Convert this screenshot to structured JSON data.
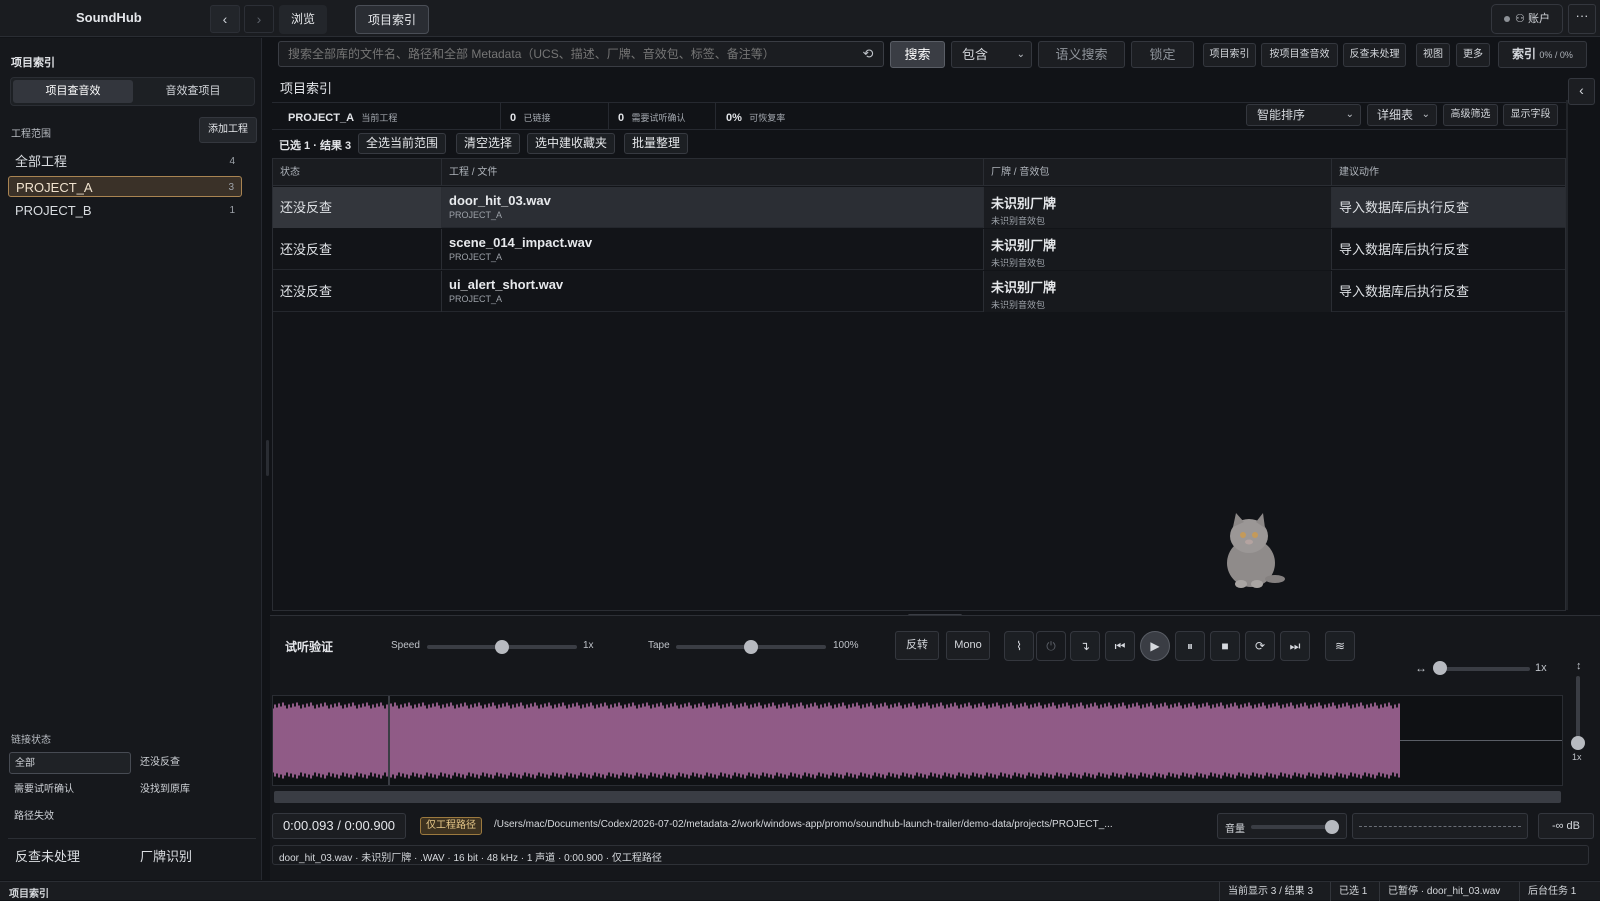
{
  "app": {
    "name": "SoundHub"
  },
  "nav": {
    "back": "‹",
    "forward": "›",
    "tabs": [
      "浏览",
      "项目索引"
    ],
    "account": "账户",
    "more": "···"
  },
  "search": {
    "placeholder": "搜索全部库的文件名、路径和全部 Metadata（UCS、描述、厂牌、音效包、标签、备注等）",
    "button": "搜索",
    "mode": "包含",
    "semantic": "语义搜索",
    "lock": "锁定"
  },
  "toolbar": {
    "items": [
      "项目索引",
      "按项目查音效",
      "反查未处理",
      "视图",
      "更多"
    ],
    "index_label": "索引",
    "index_value": "0% / 0%"
  },
  "sidebar": {
    "title": "项目索引",
    "seg": [
      "项目查音效",
      "音效查项目"
    ],
    "scope_label": "工程范围",
    "add_project": "添加工程",
    "projects": [
      {
        "name": "全部工程",
        "count": "4"
      },
      {
        "name": "PROJECT_A",
        "count": "3"
      },
      {
        "name": "PROJECT_B",
        "count": "1"
      }
    ],
    "link_label": "链接状态",
    "link_filters": [
      "全部",
      "还没反查",
      "需要试听确认",
      "没找到原库",
      "路径失效"
    ],
    "bottom": [
      "反查未处理",
      "厂牌识别"
    ]
  },
  "main": {
    "title": "项目索引",
    "summary": {
      "project": "PROJECT_A",
      "project_label": "当前工程",
      "linked": "0",
      "linked_label": "已链接",
      "confirm": "0",
      "confirm_label": "需要试听确认",
      "recover": "0%",
      "recover_label": "可恢复率"
    },
    "sort": "智能排序",
    "view": "详细表",
    "adv_filter": "高级筛选",
    "fields": "显示字段",
    "selection": "已选 1 · 结果 3",
    "actions": [
      "全选当前范围",
      "清空选择",
      "选中建收藏夹",
      "批量整理"
    ]
  },
  "table": {
    "columns": [
      "状态",
      "工程 / 文件",
      "厂牌 / 音效包",
      "建议动作"
    ],
    "rows": [
      {
        "status": "还没反查",
        "file": "door_hit_03.wav",
        "project": "PROJECT_A",
        "brand": "未识别厂牌",
        "pack": "未识别音效包",
        "action": "导入数据库后执行反查"
      },
      {
        "status": "还没反查",
        "file": "scene_014_impact.wav",
        "project": "PROJECT_A",
        "brand": "未识别厂牌",
        "pack": "未识别音效包",
        "action": "导入数据库后执行反查"
      },
      {
        "status": "还没反查",
        "file": "ui_alert_short.wav",
        "project": "PROJECT_A",
        "brand": "未识别厂牌",
        "pack": "未识别音效包",
        "action": "导入数据库后执行反查"
      }
    ]
  },
  "player": {
    "title": "试听验证",
    "speed_label": "Speed",
    "speed_value": "1x",
    "speed_level": 0.5,
    "tape_label": "Tape",
    "tape_value": "100%",
    "tape_level": 0.5,
    "reverse": "反转",
    "mono": "Mono",
    "zoom_value": "1x",
    "vzoom_value": "1x",
    "time_current": "0:00.093",
    "time_sep": "/",
    "time_total": "0:00.900",
    "path_badge": "仅工程路径",
    "path": "/Users/mac/Documents/Codex/2026-07-02/metadata-2/work/windows-app/promo/soundhub-launch-trailer/demo-data/projects/PROJECT_...",
    "volume_label": "音量",
    "db": "-∞ dB",
    "fileinfo": "door_hit_03.wav · 未识别厂牌 · .WAV · 16 bit · 48 kHz · 1 声道 · 0:00.900 · 仅工程路径",
    "waveform_color": "#c77bb8",
    "playhead_fraction": 0.103
  },
  "status": {
    "left": "项目索引",
    "items": [
      "当前显示 3 / 结果 3",
      "已选 1",
      "已暂停 · door_hit_03.wav",
      "后台任务 1"
    ]
  }
}
